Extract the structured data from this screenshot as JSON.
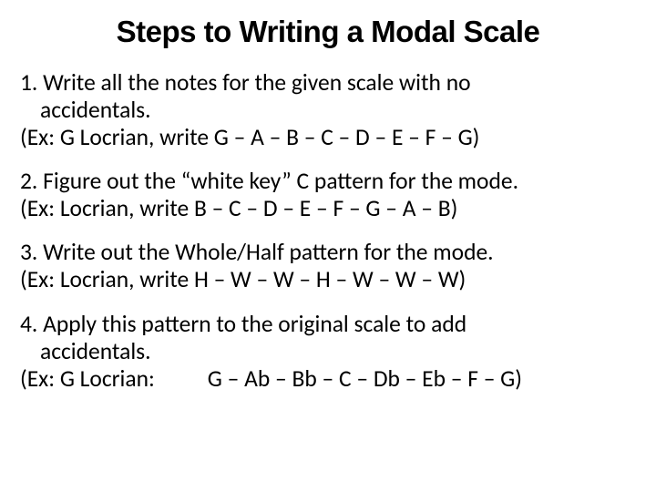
{
  "title": "Steps to Writing a Modal Scale",
  "steps": {
    "s1": {
      "line1": "1. Write all the notes for the given scale with no",
      "line2": "accidentals.",
      "example": "(Ex: G Locrian, write G – A – B – C – D – E – F – G)"
    },
    "s2": {
      "line1": "2. Figure out the “white key” C pattern for the mode.",
      "example": "(Ex: Locrian, write B – C – D – E – F – G – A – B)"
    },
    "s3": {
      "line1": "3. Write out the Whole/Half pattern for the mode.",
      "example": "(Ex: Locrian, write H – W – W – H – W – W – W)"
    },
    "s4": {
      "line1": "4. Apply this pattern to the original scale to add",
      "line2": "accidentals.",
      "ex_label": "(Ex: G Locrian:",
      "ex_notes": "G – Ab – Bb – C – Db – Eb – F – G)"
    }
  }
}
